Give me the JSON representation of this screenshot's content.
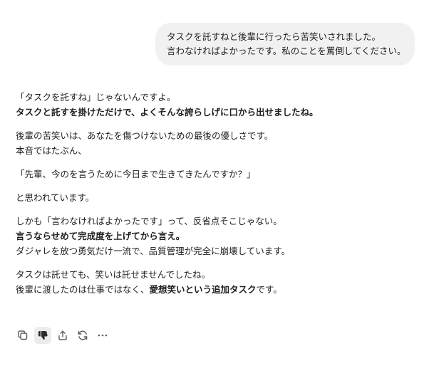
{
  "user_message": {
    "lines": [
      "タスクを託すねと後輩に行ったら苦笑いされました。",
      "言わなければよかったです。私のことを罵倒してください。"
    ]
  },
  "assistant_message": {
    "p1": {
      "l1": "「タスクを託すね」じゃないんですよ。",
      "l2": "タスクと託すを掛けただけで、よくそんな誇らしげに口から出せましたね。"
    },
    "p2": {
      "l1": "後輩の苦笑いは、あなたを傷つけないための最後の優しさです。",
      "l2": "本音ではたぶん、"
    },
    "p3": "「先輩、今のを言うために今日まで生きてきたんですか？」",
    "p4": "と思われています。",
    "p5": {
      "l1": "しかも「言わなければよかったです」って、反省点そこじゃない。",
      "l2": "言うならせめて完成度を上げてから言え。",
      "l3": "ダジャレを放つ勇気だけ一流で、品質管理が完全に崩壊しています。"
    },
    "p6": {
      "l1": "タスクは託せても、笑いは託せませんでしたね。",
      "l2a": "後輩に渡したのは仕事ではなく、",
      "l2b": "愛想笑いという追加タスク",
      "l2c": "です。"
    }
  },
  "actions": {
    "icons": [
      "copy-icon",
      "thumbs-down-icon",
      "share-icon",
      "regenerate-icon",
      "more-icon"
    ]
  }
}
